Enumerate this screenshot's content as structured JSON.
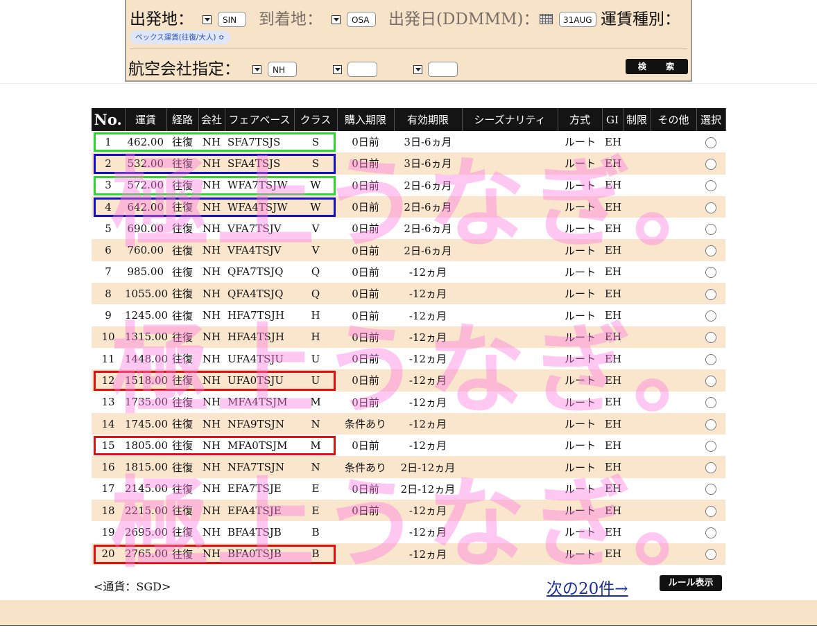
{
  "search_form": {
    "origin_label": "出発地：",
    "origin_value": "SIN",
    "destination_label": "到着地：",
    "destination_value": "OSA",
    "date_label": "出発日(DDMMM)：",
    "date_value": "31AUG",
    "fare_type_label": "運賃種別：",
    "fare_type_value": "ペックス運賃(往復/大人) ≎",
    "airline_label": "航空会社指定：",
    "airline_1": "NH",
    "airline_2": "",
    "airline_3": "",
    "search_button": "検 索"
  },
  "table": {
    "headers": [
      "No.",
      "運賃",
      "経路",
      "会社",
      "フェアベース",
      "クラス",
      "購入期限",
      "有効期限",
      "シーズナリティ",
      "方式",
      "GI",
      "制限",
      "その他",
      "選択"
    ],
    "rows": [
      {
        "no": "1",
        "fare": "462.00",
        "route": "往復",
        "carrier": "NH",
        "fare_basis": "SFA7TSJS",
        "class": "S",
        "purchase": "0日前",
        "validity": "3日-6ヵ月",
        "seasonality": "",
        "method": "ルート",
        "gi": "EH"
      },
      {
        "no": "2",
        "fare": "532.00",
        "route": "往復",
        "carrier": "NH",
        "fare_basis": "SFA4TSJS",
        "class": "S",
        "purchase": "0日前",
        "validity": "3日-6ヵ月",
        "seasonality": "",
        "method": "ルート",
        "gi": "EH"
      },
      {
        "no": "3",
        "fare": "572.00",
        "route": "往復",
        "carrier": "NH",
        "fare_basis": "WFA7TSJW",
        "class": "W",
        "purchase": "0日前",
        "validity": "2日-6ヵ月",
        "seasonality": "",
        "method": "ルート",
        "gi": "EH"
      },
      {
        "no": "4",
        "fare": "642.00",
        "route": "往復",
        "carrier": "NH",
        "fare_basis": "WFA4TSJW",
        "class": "W",
        "purchase": "0日前",
        "validity": "2日-6ヵ月",
        "seasonality": "",
        "method": "ルート",
        "gi": "EH"
      },
      {
        "no": "5",
        "fare": "690.00",
        "route": "往復",
        "carrier": "NH",
        "fare_basis": "VFA7TSJV",
        "class": "V",
        "purchase": "0日前",
        "validity": "2日-6ヵ月",
        "seasonality": "",
        "method": "ルート",
        "gi": "EH"
      },
      {
        "no": "6",
        "fare": "760.00",
        "route": "往復",
        "carrier": "NH",
        "fare_basis": "VFA4TSJV",
        "class": "V",
        "purchase": "0日前",
        "validity": "2日-6ヵ月",
        "seasonality": "",
        "method": "ルート",
        "gi": "EH"
      },
      {
        "no": "7",
        "fare": "985.00",
        "route": "往復",
        "carrier": "NH",
        "fare_basis": "QFA7TSJQ",
        "class": "Q",
        "purchase": "0日前",
        "validity": "-12ヵ月",
        "seasonality": "",
        "method": "ルート",
        "gi": "EH"
      },
      {
        "no": "8",
        "fare": "1055.00",
        "route": "往復",
        "carrier": "NH",
        "fare_basis": "QFA4TSJQ",
        "class": "Q",
        "purchase": "0日前",
        "validity": "-12ヵ月",
        "seasonality": "",
        "method": "ルート",
        "gi": "EH"
      },
      {
        "no": "9",
        "fare": "1245.00",
        "route": "往復",
        "carrier": "NH",
        "fare_basis": "HFA7TSJH",
        "class": "H",
        "purchase": "0日前",
        "validity": "-12ヵ月",
        "seasonality": "",
        "method": "ルート",
        "gi": "EH"
      },
      {
        "no": "10",
        "fare": "1315.00",
        "route": "往復",
        "carrier": "NH",
        "fare_basis": "HFA4TSJH",
        "class": "H",
        "purchase": "0日前",
        "validity": "-12ヵ月",
        "seasonality": "",
        "method": "ルート",
        "gi": "EH"
      },
      {
        "no": "11",
        "fare": "1448.00",
        "route": "往復",
        "carrier": "NH",
        "fare_basis": "UFA4TSJU",
        "class": "U",
        "purchase": "0日前",
        "validity": "-12ヵ月",
        "seasonality": "",
        "method": "ルート",
        "gi": "EH"
      },
      {
        "no": "12",
        "fare": "1518.00",
        "route": "往復",
        "carrier": "NH",
        "fare_basis": "UFA0TSJU",
        "class": "U",
        "purchase": "0日前",
        "validity": "-12ヵ月",
        "seasonality": "",
        "method": "ルート",
        "gi": "EH"
      },
      {
        "no": "13",
        "fare": "1735.00",
        "route": "往復",
        "carrier": "NH",
        "fare_basis": "MFA4TSJM",
        "class": "M",
        "purchase": "0日前",
        "validity": "-12ヵ月",
        "seasonality": "",
        "method": "ルート",
        "gi": "EH"
      },
      {
        "no": "14",
        "fare": "1745.00",
        "route": "往復",
        "carrier": "NH",
        "fare_basis": "NFA9TSJN",
        "class": "N",
        "purchase": "条件あり",
        "validity": "-12ヵ月",
        "seasonality": "",
        "method": "ルート",
        "gi": "EH"
      },
      {
        "no": "15",
        "fare": "1805.00",
        "route": "往復",
        "carrier": "NH",
        "fare_basis": "MFA0TSJM",
        "class": "M",
        "purchase": "0日前",
        "validity": "-12ヵ月",
        "seasonality": "",
        "method": "ルート",
        "gi": "EH"
      },
      {
        "no": "16",
        "fare": "1815.00",
        "route": "往復",
        "carrier": "NH",
        "fare_basis": "NFA7TSJN",
        "class": "N",
        "purchase": "条件あり",
        "validity": "2日-12ヵ月",
        "seasonality": "",
        "method": "ルート",
        "gi": "EH"
      },
      {
        "no": "17",
        "fare": "2145.00",
        "route": "往復",
        "carrier": "NH",
        "fare_basis": "EFA7TSJE",
        "class": "E",
        "purchase": "0日前",
        "validity": "2日-12ヵ月",
        "seasonality": "",
        "method": "ルート",
        "gi": "EH"
      },
      {
        "no": "18",
        "fare": "2215.00",
        "route": "往復",
        "carrier": "NH",
        "fare_basis": "EFA4TSJE",
        "class": "E",
        "purchase": "0日前",
        "validity": "-12ヵ月",
        "seasonality": "",
        "method": "ルート",
        "gi": "EH"
      },
      {
        "no": "19",
        "fare": "2695.00",
        "route": "往復",
        "carrier": "NH",
        "fare_basis": "BFA4TSJB",
        "class": "B",
        "purchase": "",
        "validity": "-12ヵ月",
        "seasonality": "",
        "method": "ルート",
        "gi": "EH"
      },
      {
        "no": "20",
        "fare": "2765.00",
        "route": "往復",
        "carrier": "NH",
        "fare_basis": "BFA0TSJB",
        "class": "B",
        "purchase": "",
        "validity": "-12ヵ月",
        "seasonality": "",
        "method": "ルート",
        "gi": "EH"
      }
    ]
  },
  "highlights": [
    {
      "row": 1,
      "color": "#2fd62f"
    },
    {
      "row": 2,
      "color": "#1010c8"
    },
    {
      "row": 3,
      "color": "#2fd62f"
    },
    {
      "row": 4,
      "color": "#1010c8"
    },
    {
      "row": 12,
      "color": "#e01010"
    },
    {
      "row": 15,
      "color": "#e01010"
    },
    {
      "row": 20,
      "color": "#e01010"
    }
  ],
  "watermark": {
    "text": "極上うなぎ。"
  },
  "footer": {
    "currency": "<通貨：SGD>",
    "next_link": "次の20件→",
    "rule_button": "ルール表示"
  }
}
